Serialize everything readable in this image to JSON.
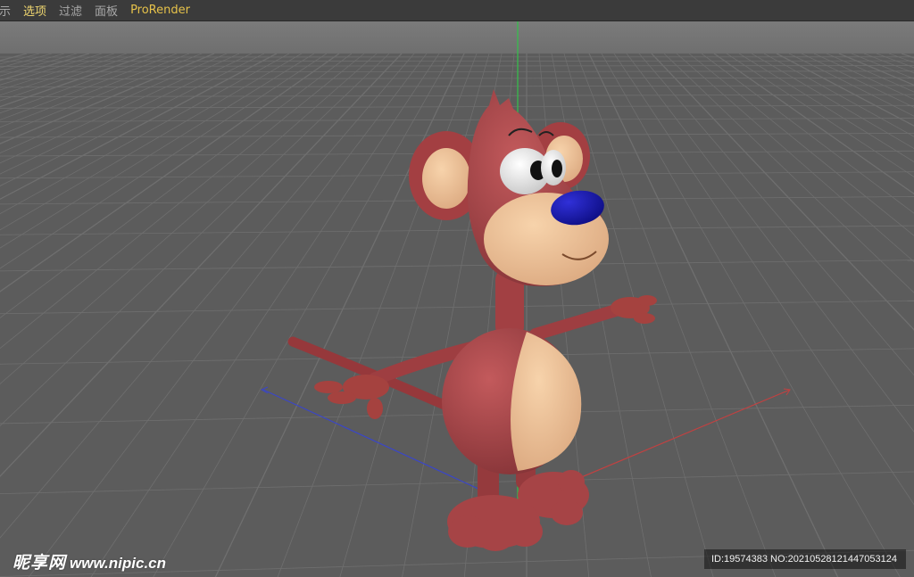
{
  "menu": {
    "items": [
      {
        "label": "示",
        "active": false
      },
      {
        "label": "选项",
        "active": true
      },
      {
        "label": "过滤",
        "active": false
      },
      {
        "label": "面板",
        "active": false
      },
      {
        "label": "ProRender",
        "active": false
      }
    ]
  },
  "viewport": {
    "background": "#5f5f5f",
    "grid_color": "#6f6f6f",
    "axis_colors": {
      "x": "#c0392b",
      "y": "#2ecc40",
      "z": "#2f3dbf"
    },
    "model": {
      "body_color": "#a84548",
      "face_color": "#f0c49a",
      "nose_color": "#1a1aa8"
    }
  },
  "watermark": {
    "logo_text": "昵享网",
    "site_text": "www.nipic.cn",
    "id_text": "ID:19574383 NO:20210528121447053124"
  }
}
